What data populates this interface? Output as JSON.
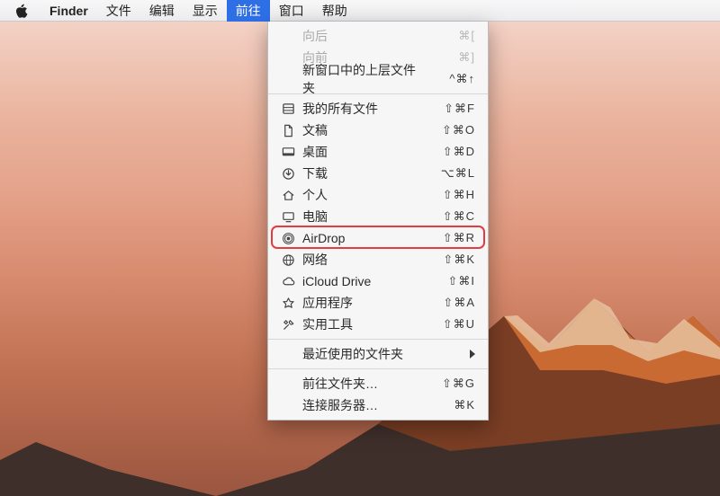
{
  "menubar": {
    "app": "Finder",
    "items": [
      {
        "label": "文件"
      },
      {
        "label": "编辑"
      },
      {
        "label": "显示"
      },
      {
        "label": "前往",
        "selected": true
      },
      {
        "label": "窗口"
      },
      {
        "label": "帮助"
      }
    ]
  },
  "dropdown": {
    "back": {
      "label": "向后",
      "shortcut": "⌘["
    },
    "forward": {
      "label": "向前",
      "shortcut": "⌘]"
    },
    "enclosing": {
      "label": "新窗口中的上层文件夹",
      "shortcut": "^⌘↑"
    },
    "allfiles": {
      "label": "我的所有文件",
      "shortcut": "⇧⌘F"
    },
    "documents": {
      "label": "文稿",
      "shortcut": "⇧⌘O"
    },
    "desktop": {
      "label": "桌面",
      "shortcut": "⇧⌘D"
    },
    "downloads": {
      "label": "下载",
      "shortcut": "⌥⌘L"
    },
    "home": {
      "label": "个人",
      "shortcut": "⇧⌘H"
    },
    "computer": {
      "label": "电脑",
      "shortcut": "⇧⌘C"
    },
    "airdrop": {
      "label": "AirDrop",
      "shortcut": "⇧⌘R"
    },
    "network": {
      "label": "网络",
      "shortcut": "⇧⌘K"
    },
    "icloud": {
      "label": "iCloud Drive",
      "shortcut": "⇧⌘I"
    },
    "applications": {
      "label": "应用程序",
      "shortcut": "⇧⌘A"
    },
    "utilities": {
      "label": "实用工具",
      "shortcut": "⇧⌘U"
    },
    "recent": {
      "label": "最近使用的文件夹"
    },
    "gotofolder": {
      "label": "前往文件夹…",
      "shortcut": "⇧⌘G"
    },
    "connect": {
      "label": "连接服务器…",
      "shortcut": "⌘K"
    }
  }
}
